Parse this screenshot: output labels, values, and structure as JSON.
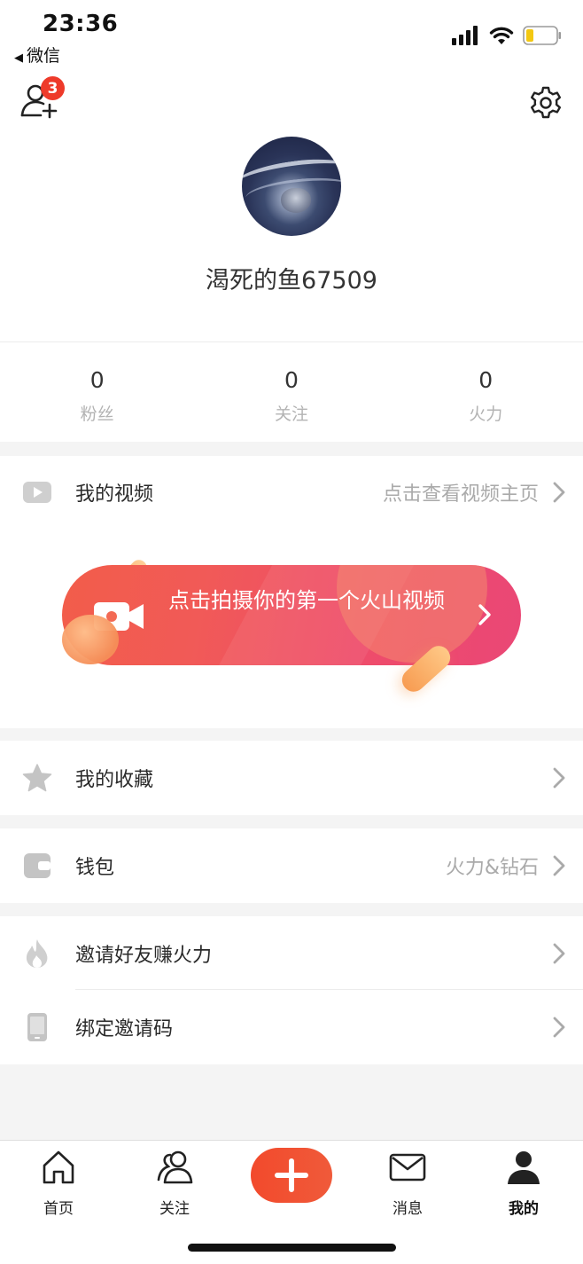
{
  "status_bar": {
    "time": "23:36",
    "back_label": "微信",
    "back_arrow": "◀",
    "icons": [
      "signal-icon",
      "wifi-icon",
      "battery-icon"
    ],
    "battery_level": 0.25
  },
  "header": {
    "add_friend_badge": "3",
    "icons": [
      "add-friend-icon",
      "settings-icon"
    ]
  },
  "profile": {
    "username": "渴死的鱼67509"
  },
  "stats": [
    {
      "value": "0",
      "label": "粉丝"
    },
    {
      "value": "0",
      "label": "关注"
    },
    {
      "value": "0",
      "label": "火力"
    }
  ],
  "menu": {
    "my_videos": {
      "label": "我的视频",
      "sub": "点击查看视频主页",
      "icon": "video-play-icon"
    },
    "banner": {
      "text": "点击拍摄你的第一个火山视频",
      "icon": "video-camera-icon"
    },
    "favorites": {
      "label": "我的收藏",
      "icon": "star-icon"
    },
    "wallet": {
      "label": "钱包",
      "sub": "火力&钻石",
      "icon": "wallet-icon"
    },
    "invite": {
      "label": "邀请好友赚火力",
      "icon": "flame-icon"
    },
    "bind_code": {
      "label": "绑定邀请码",
      "icon": "phone-icon"
    }
  },
  "tabbar": {
    "items": [
      {
        "label": "首页",
        "icon": "home-icon"
      },
      {
        "label": "关注",
        "icon": "users-icon"
      },
      {
        "label": "",
        "icon": "plus-icon"
      },
      {
        "label": "消息",
        "icon": "mail-icon"
      },
      {
        "label": "我的",
        "icon": "person-icon"
      }
    ],
    "active": "我的"
  },
  "colors": {
    "accent": "#f24a2c",
    "banner_start": "#f25d4a",
    "banner_end": "#ea4776",
    "badge": "#ee3a2a"
  }
}
